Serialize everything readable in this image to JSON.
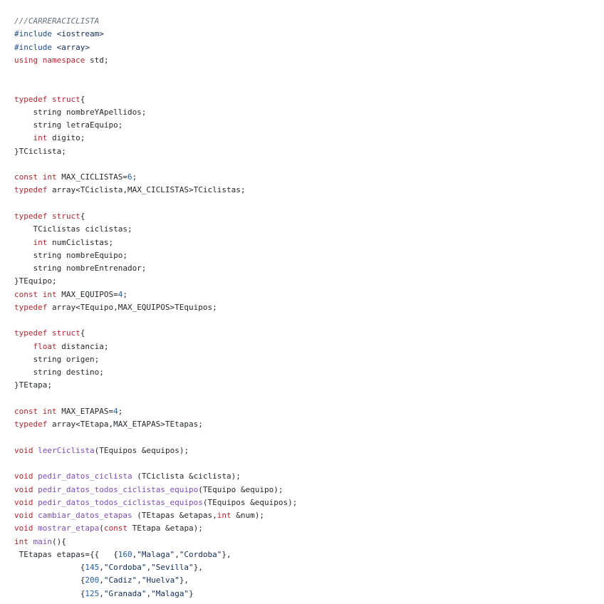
{
  "editor": {
    "language": "cpp",
    "colors": {
      "background": "#ffffff",
      "keyword": "#b0282f",
      "preprocessor": "#1f4c8c",
      "comment": "#6a737d",
      "function": "#7d4cb8",
      "number": "#1f5fa8",
      "string": "#0f2a55",
      "text": "#24292e"
    },
    "lines": [
      [
        {
          "t": "cm",
          "v": "///CARRERACICLISTA"
        }
      ],
      [
        {
          "t": "pp",
          "v": "#include"
        },
        {
          "t": "",
          "v": " "
        },
        {
          "t": "inc",
          "v": "<iostream>"
        }
      ],
      [
        {
          "t": "pp",
          "v": "#include"
        },
        {
          "t": "",
          "v": " "
        },
        {
          "t": "inc",
          "v": "<array>"
        }
      ],
      [
        {
          "t": "kw",
          "v": "using"
        },
        {
          "t": "",
          "v": " "
        },
        {
          "t": "kw",
          "v": "namespace"
        },
        {
          "t": "",
          "v": " std;"
        }
      ],
      [],
      [],
      [
        {
          "t": "kw",
          "v": "typedef"
        },
        {
          "t": "",
          "v": " "
        },
        {
          "t": "kw",
          "v": "struct"
        },
        {
          "t": "",
          "v": "{"
        }
      ],
      [
        {
          "t": "",
          "v": "    string nombreYApellidos;"
        }
      ],
      [
        {
          "t": "",
          "v": "    string letraEquipo;"
        }
      ],
      [
        {
          "t": "",
          "v": "    "
        },
        {
          "t": "kw",
          "v": "int"
        },
        {
          "t": "",
          "v": " digito;"
        }
      ],
      [
        {
          "t": "",
          "v": "}TCiclista;"
        }
      ],
      [],
      [
        {
          "t": "kw",
          "v": "const"
        },
        {
          "t": "",
          "v": " "
        },
        {
          "t": "kw",
          "v": "int"
        },
        {
          "t": "",
          "v": " MAX_CICLISTAS="
        },
        {
          "t": "num",
          "v": "6"
        },
        {
          "t": "",
          "v": ";"
        }
      ],
      [
        {
          "t": "kw",
          "v": "typedef"
        },
        {
          "t": "",
          "v": " array<TCiclista,MAX_CICLISTAS>TCiclistas;"
        }
      ],
      [],
      [
        {
          "t": "kw",
          "v": "typedef"
        },
        {
          "t": "",
          "v": " "
        },
        {
          "t": "kw",
          "v": "struct"
        },
        {
          "t": "",
          "v": "{"
        }
      ],
      [
        {
          "t": "",
          "v": "    TCiclistas ciclistas;"
        }
      ],
      [
        {
          "t": "",
          "v": "    "
        },
        {
          "t": "kw",
          "v": "int"
        },
        {
          "t": "",
          "v": " numCiclistas;"
        }
      ],
      [
        {
          "t": "",
          "v": "    string nombreEquipo;"
        }
      ],
      [
        {
          "t": "",
          "v": "    string nombreEntrenador;"
        }
      ],
      [
        {
          "t": "",
          "v": "}TEquipo;"
        }
      ],
      [
        {
          "t": "kw",
          "v": "const"
        },
        {
          "t": "",
          "v": " "
        },
        {
          "t": "kw",
          "v": "int"
        },
        {
          "t": "",
          "v": " MAX_EQUIPOS="
        },
        {
          "t": "num",
          "v": "4"
        },
        {
          "t": "",
          "v": ";"
        }
      ],
      [
        {
          "t": "kw",
          "v": "typedef"
        },
        {
          "t": "",
          "v": " array<TEquipo,MAX_EQUIPOS>TEquipos;"
        }
      ],
      [],
      [
        {
          "t": "kw",
          "v": "typedef"
        },
        {
          "t": "",
          "v": " "
        },
        {
          "t": "kw",
          "v": "struct"
        },
        {
          "t": "",
          "v": "{"
        }
      ],
      [
        {
          "t": "",
          "v": "    "
        },
        {
          "t": "kw",
          "v": "float"
        },
        {
          "t": "",
          "v": " distancia;"
        }
      ],
      [
        {
          "t": "",
          "v": "    string origen;"
        }
      ],
      [
        {
          "t": "",
          "v": "    string destino;"
        }
      ],
      [
        {
          "t": "",
          "v": "}TEtapa;"
        }
      ],
      [],
      [
        {
          "t": "kw",
          "v": "const"
        },
        {
          "t": "",
          "v": " "
        },
        {
          "t": "kw",
          "v": "int"
        },
        {
          "t": "",
          "v": " MAX_ETAPAS="
        },
        {
          "t": "num",
          "v": "4"
        },
        {
          "t": "",
          "v": ";"
        }
      ],
      [
        {
          "t": "kw",
          "v": "typedef"
        },
        {
          "t": "",
          "v": " array<TEtapa,MAX_ETAPAS>TEtapas;"
        }
      ],
      [],
      [
        {
          "t": "kw",
          "v": "void"
        },
        {
          "t": "",
          "v": " "
        },
        {
          "t": "fn",
          "v": "leerCiclista"
        },
        {
          "t": "",
          "v": "(TEquipos &equipos);"
        }
      ],
      [],
      [
        {
          "t": "kw",
          "v": "void"
        },
        {
          "t": "",
          "v": " "
        },
        {
          "t": "fn",
          "v": "pedir_datos_ciclista"
        },
        {
          "t": "",
          "v": " (TCiclista &ciclista);"
        }
      ],
      [
        {
          "t": "kw",
          "v": "void"
        },
        {
          "t": "",
          "v": " "
        },
        {
          "t": "fn",
          "v": "pedir_datos_todos_ciclistas_equipo"
        },
        {
          "t": "",
          "v": "(TEquipo &equipo);"
        }
      ],
      [
        {
          "t": "kw",
          "v": "void"
        },
        {
          "t": "",
          "v": " "
        },
        {
          "t": "fn",
          "v": "pedir_datos_todos_ciclistas_equipos"
        },
        {
          "t": "",
          "v": "(TEquipos &equipos);"
        }
      ],
      [
        {
          "t": "kw",
          "v": "void"
        },
        {
          "t": "",
          "v": " "
        },
        {
          "t": "fn",
          "v": "cambiar_datos_etapas"
        },
        {
          "t": "",
          "v": " (TEtapas &etapas,"
        },
        {
          "t": "kw",
          "v": "int"
        },
        {
          "t": "",
          "v": " &num);"
        }
      ],
      [
        {
          "t": "kw",
          "v": "void"
        },
        {
          "t": "",
          "v": " "
        },
        {
          "t": "fn",
          "v": "mostrar_etapa"
        },
        {
          "t": "",
          "v": "("
        },
        {
          "t": "kw",
          "v": "const"
        },
        {
          "t": "",
          "v": " TEtapa &etapa);"
        }
      ],
      [
        {
          "t": "kw",
          "v": "int"
        },
        {
          "t": "",
          "v": " "
        },
        {
          "t": "fn",
          "v": "main"
        },
        {
          "t": "",
          "v": "(){"
        }
      ],
      [
        {
          "t": "",
          "v": " TEtapas etapas={{   {"
        },
        {
          "t": "num",
          "v": "160"
        },
        {
          "t": "",
          "v": ","
        },
        {
          "t": "str",
          "v": "\"Malaga\""
        },
        {
          "t": "",
          "v": ","
        },
        {
          "t": "str",
          "v": "\"Cordoba\""
        },
        {
          "t": "",
          "v": "},"
        }
      ],
      [
        {
          "t": "",
          "v": "              {"
        },
        {
          "t": "num",
          "v": "145"
        },
        {
          "t": "",
          "v": ","
        },
        {
          "t": "str",
          "v": "\"Cordoba\""
        },
        {
          "t": "",
          "v": ","
        },
        {
          "t": "str",
          "v": "\"Sevilla\""
        },
        {
          "t": "",
          "v": "},"
        }
      ],
      [
        {
          "t": "",
          "v": "              {"
        },
        {
          "t": "num",
          "v": "200"
        },
        {
          "t": "",
          "v": ","
        },
        {
          "t": "str",
          "v": "\"Cadiz\""
        },
        {
          "t": "",
          "v": ","
        },
        {
          "t": "str",
          "v": "\"Huelva\""
        },
        {
          "t": "",
          "v": "},"
        }
      ],
      [
        {
          "t": "",
          "v": "              {"
        },
        {
          "t": "num",
          "v": "125"
        },
        {
          "t": "",
          "v": ","
        },
        {
          "t": "str",
          "v": "\"Granada\""
        },
        {
          "t": "",
          "v": ","
        },
        {
          "t": "str",
          "v": "\"Malaga\""
        },
        {
          "t": "",
          "v": "}"
        }
      ]
    ]
  }
}
